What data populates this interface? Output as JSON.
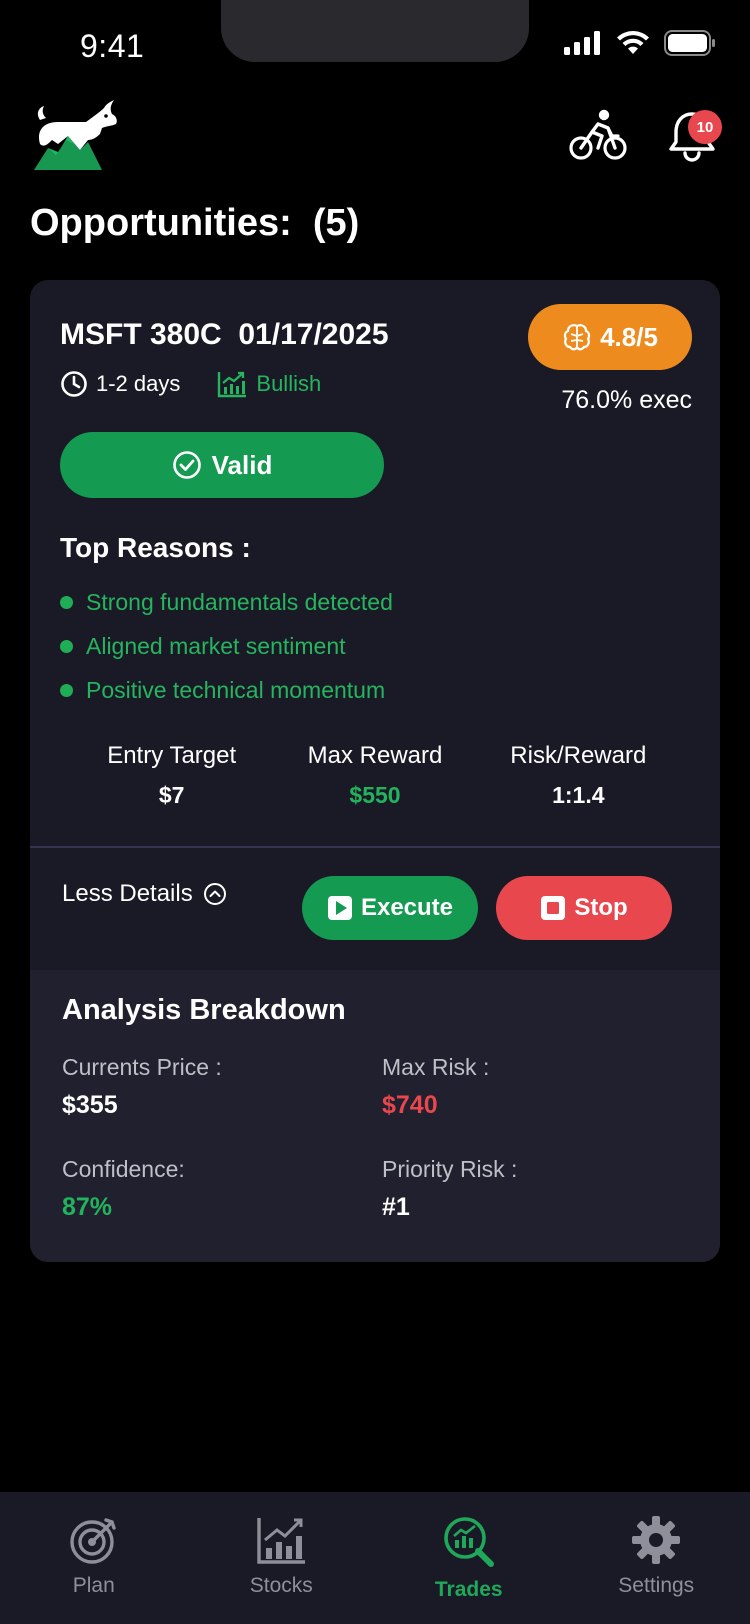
{
  "status_bar": {
    "time": "9:41"
  },
  "header": {
    "notification_count": "10"
  },
  "page": {
    "title": "Opportunities:  (5)"
  },
  "card": {
    "contract": "MSFT 380C  01/17/2025",
    "duration": "1-2 days",
    "sentiment": "Bullish",
    "score": "4.8/5",
    "exec_rate": "76.0% exec",
    "valid_label": "Valid",
    "reasons_title": "Top Reasons :",
    "reasons": [
      "Strong fundamentals detected",
      "Aligned market sentiment",
      "Positive technical momentum"
    ],
    "stats": [
      {
        "label": "Entry Target",
        "value": "$7"
      },
      {
        "label": "Max Reward",
        "value": "$550"
      },
      {
        "label": "Risk/Reward",
        "value": "1:1.4"
      }
    ],
    "less_details_label": "Less Details",
    "execute_label": "Execute",
    "stop_label": "Stop"
  },
  "analysis": {
    "title": "Analysis Breakdown",
    "current_price": {
      "label": "Currents Price :",
      "value": "$355"
    },
    "max_risk": {
      "label": "Max Risk :",
      "value": "$740"
    },
    "confidence": {
      "label": "Confidence:",
      "value": "87%"
    },
    "priority_risk": {
      "label": "Priority Risk :",
      "value": "#1"
    }
  },
  "tabs": [
    {
      "label": "Plan",
      "icon": "target-icon"
    },
    {
      "label": "Stocks",
      "icon": "bar-chart-icon"
    },
    {
      "label": "Trades",
      "icon": "trades-search-icon",
      "active": true
    },
    {
      "label": "Settings",
      "icon": "gear-icon"
    }
  ],
  "colors": {
    "accent_green": "#159a52",
    "reason_green": "#26b45e",
    "score_orange": "#ee8b1f",
    "danger_red": "#e8474e",
    "card_bg": "#1a1a26"
  }
}
